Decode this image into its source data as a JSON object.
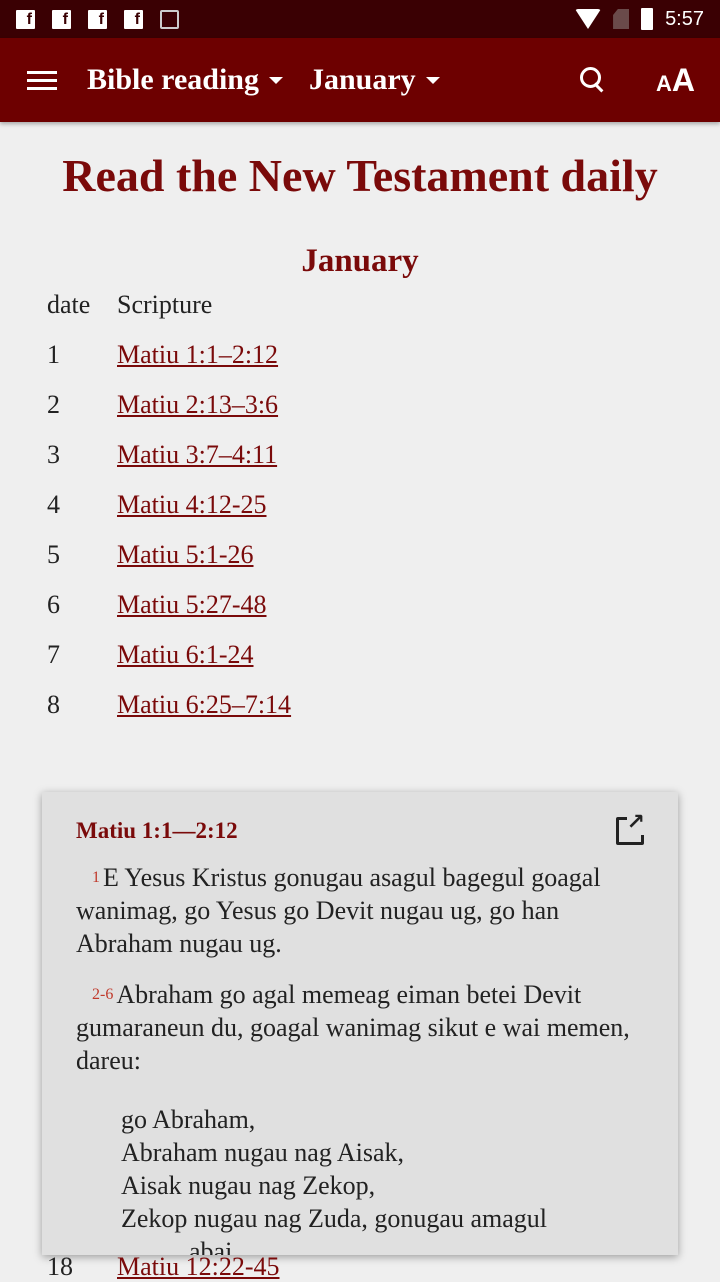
{
  "status": {
    "time": "5:57",
    "icons": [
      "facebook-icon",
      "facebook-icon",
      "facebook-icon",
      "facebook-icon",
      "image-icon",
      "wifi-icon",
      "no-sim-icon",
      "battery-icon"
    ]
  },
  "toolbar": {
    "book": "Bible reading",
    "month": "January"
  },
  "page": {
    "title": "Read the New Testament daily",
    "month": "January",
    "col_date": "date",
    "col_scripture": "Scripture",
    "rows": [
      {
        "d": "1",
        "s": "Matiu 1:1–2:12"
      },
      {
        "d": "2",
        "s": "Matiu 2:13–3:6"
      },
      {
        "d": "3",
        "s": "Matiu 3:7–4:11"
      },
      {
        "d": "4",
        "s": "Matiu 4:12-25"
      },
      {
        "d": "5",
        "s": "Matiu 5:1-26"
      },
      {
        "d": "6",
        "s": "Matiu 5:27-48"
      },
      {
        "d": "7",
        "s": "Matiu 6:1-24"
      },
      {
        "d": "8",
        "s": "Matiu 6:25–7:14"
      }
    ],
    "row18": {
      "d": "18",
      "s": "Matiu 12:22-45"
    }
  },
  "popup": {
    "title": "Matiu 1:1—2:12",
    "v1": "1",
    "t1": "E Yesus Kristus gonugau asagul bagegul goagal wanimag, go Yesus go Devit nugau ug, go han Abraham nugau ug.",
    "v2": "2-6",
    "t2": "Abraham go agal memeag eiman betei Devit gumaraneun du, goagal wanimag sikut e wai memen, dareu:",
    "poem": [
      "go Abraham,",
      "Abraham nugau nag Aisak,",
      "Aisak nugau nag Zekop,",
      "Zekop nugau nag Zuda, gonugau amagul",
      "abai"
    ]
  }
}
